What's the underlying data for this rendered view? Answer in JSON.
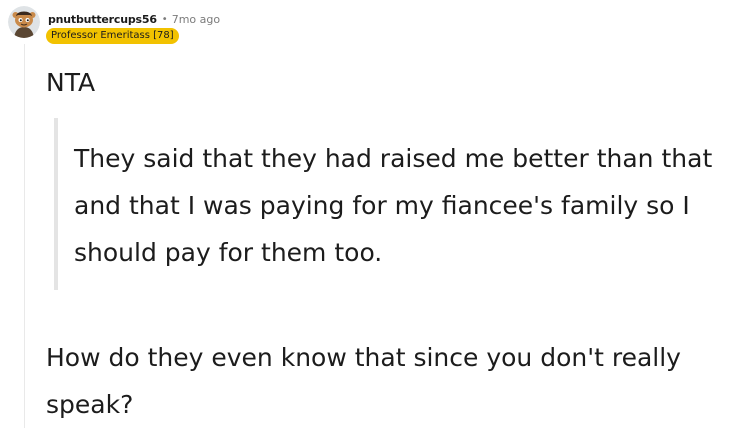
{
  "comment": {
    "username": "pnutbuttercups56",
    "separator": "•",
    "time": "7mo ago",
    "flair": "Professor Emeritass [78]",
    "avatar_icon": "snoo-avatar-icon",
    "flair_color": "#f2c200",
    "body": {
      "verdict": "NTA",
      "quote": "They said that they had raised me better than that and that I was paying for my fiancee's family so I should pay for them too.",
      "reply": "How do they even know that since you don't really speak?"
    }
  }
}
